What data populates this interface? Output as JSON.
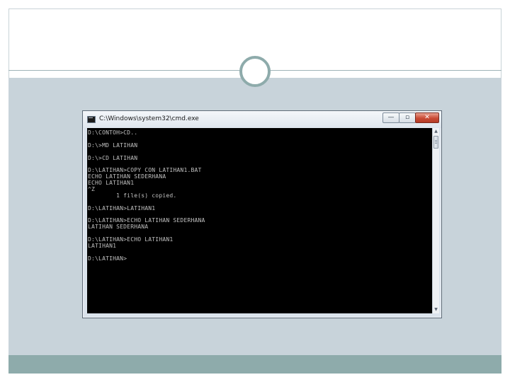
{
  "slide": {
    "theme_colors": {
      "body": "#c8d3da",
      "footer": "#8eabab",
      "circle_border": "#8eabab"
    }
  },
  "window": {
    "title": "C:\\Windows\\system32\\cmd.exe",
    "controls": {
      "minimize_icon": "—",
      "maximize_icon": "▫",
      "close_icon": "✕"
    },
    "icon": "console-icon",
    "scroll": {
      "up_icon": "▲",
      "down_icon": "▼"
    }
  },
  "console": {
    "lines": [
      "D:\\CONTOH>CD..",
      "",
      "D:\\>MD LATIHAN",
      "",
      "D:\\>CD LATIHAN",
      "",
      "D:\\LATIHAN>COPY CON LATIHAN1.BAT",
      "ECHO LATIHAN SEDERHANA",
      "ECHO LATIHAN1",
      "^Z",
      "        1 file(s) copied.",
      "",
      "D:\\LATIHAN>LATIHAN1",
      "",
      "D:\\LATIHAN>ECHO LATIHAN SEDERHANA",
      "LATIHAN SEDERHANA",
      "",
      "D:\\LATIHAN>ECHO LATIHAN1",
      "LATIHAN1",
      "",
      "D:\\LATIHAN>"
    ]
  }
}
